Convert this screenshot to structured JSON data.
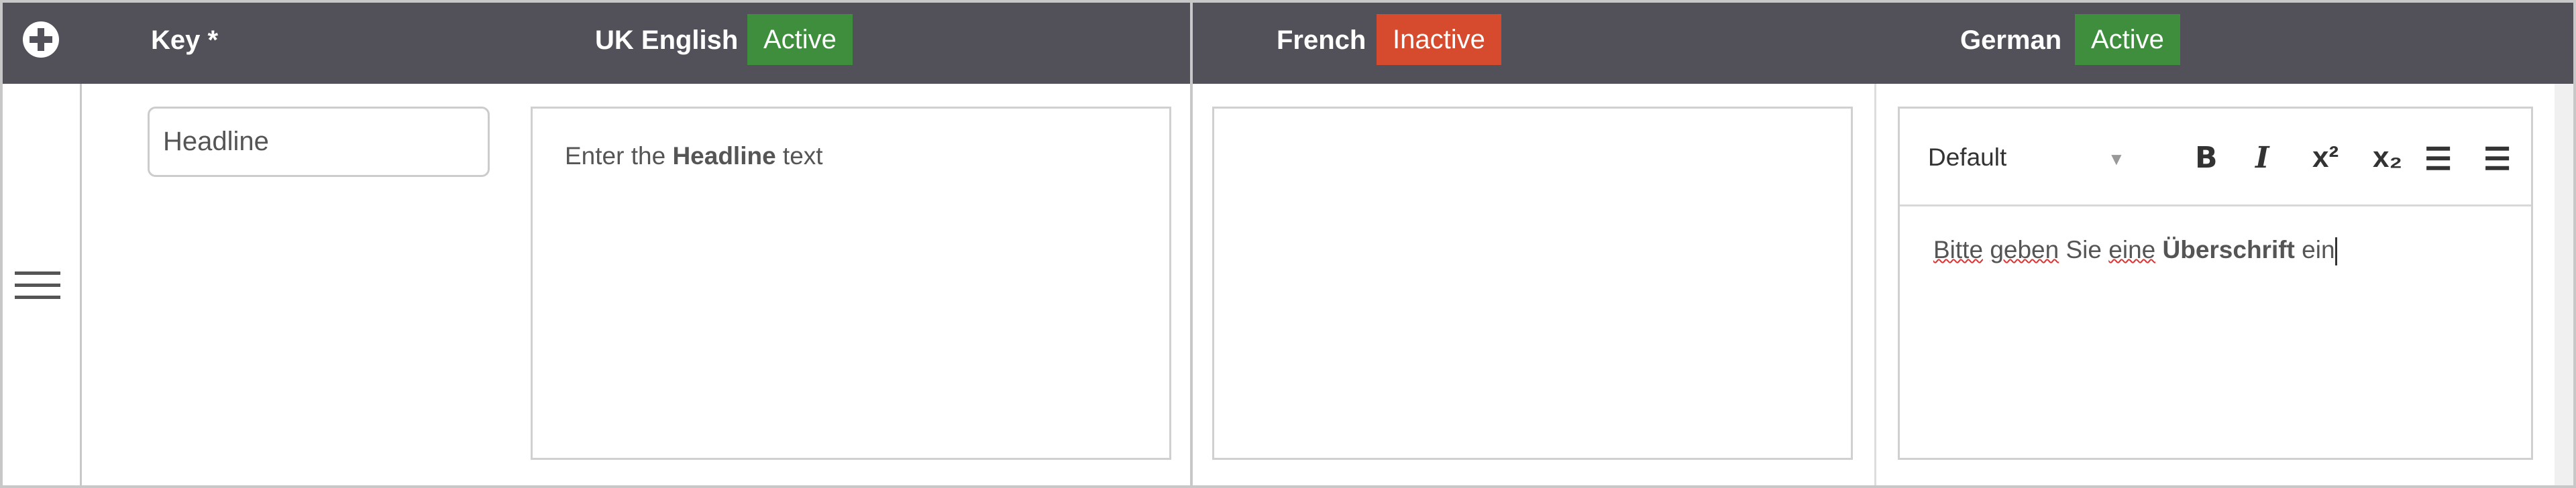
{
  "header": {
    "add_icon": "plus-circle-icon",
    "key_label": "Key *",
    "languages": [
      {
        "name": "UK English",
        "status": "Active",
        "status_color": "#3e8e3e"
      },
      {
        "name": "French",
        "status": "Inactive",
        "status_color": "#d64a2e"
      },
      {
        "name": "German",
        "status": "Active",
        "status_color": "#3e8e3e"
      }
    ]
  },
  "row": {
    "drag_icon": "hamburger-icon",
    "key_value": "Headline",
    "uk": {
      "pre": "Enter the ",
      "bold": "Headline",
      "post": " text"
    },
    "french": {
      "text": ""
    },
    "german": {
      "toolbar": {
        "style_select": "Default",
        "buttons": [
          "B",
          "I",
          "x²",
          "x₂",
          "bulleted-list",
          "numbered-list"
        ]
      },
      "words": [
        "Bitte",
        "geben",
        "Sie",
        "eine"
      ],
      "bold": "Überschrift",
      "post": "ein"
    }
  }
}
